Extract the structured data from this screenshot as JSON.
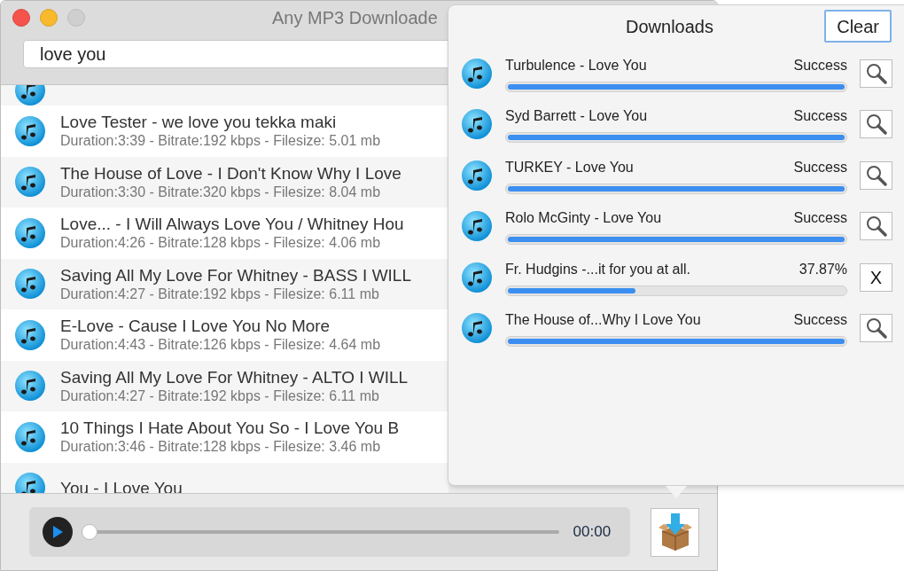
{
  "window": {
    "title": "Any MP3 Downloade"
  },
  "search": {
    "value": "love you"
  },
  "results": [
    {
      "title": "Love Tester - we love you tekka maki",
      "details": "Duration:3:39 - Bitrate:192 kbps - Filesize: 5.01 mb"
    },
    {
      "title": "The House of Love - I Don't Know Why I Love",
      "details": "Duration:3:30 - Bitrate:320 kbps - Filesize: 8.04 mb"
    },
    {
      "title": "Love... - I Will Always Love You / Whitney Hou",
      "details": "Duration:4:26 - Bitrate:128 kbps - Filesize: 4.06 mb"
    },
    {
      "title": "Saving All My Love For Whitney - BASS I WILL",
      "details": "Duration:4:27 - Bitrate:192 kbps - Filesize: 6.11 mb"
    },
    {
      "title": "E-Love - Cause I Love You No More",
      "details": "Duration:4:43 - Bitrate:126 kbps - Filesize: 4.64 mb"
    },
    {
      "title": "Saving All My Love For Whitney - ALTO I WILL",
      "details": "Duration:4:27 - Bitrate:192 kbps - Filesize: 6.11 mb"
    },
    {
      "title": "10 Things I Hate About You So - I Love You B",
      "details": "Duration:3:46 - Bitrate:128 kbps - Filesize: 3.46 mb"
    },
    {
      "title": "You - I Love You"
    }
  ],
  "player": {
    "level": 0,
    "time": "00:00"
  },
  "downloads": {
    "title": "Downloads",
    "clear_button": "Clear",
    "items": [
      {
        "kind": "done",
        "name": "Turbulence - Love You",
        "status": "Success",
        "level": 1
      },
      {
        "kind": "done",
        "name": "Syd Barrett - Love You",
        "status": "Success",
        "level": 1
      },
      {
        "kind": "done",
        "name": "TURKEY - Love You",
        "status": "Success",
        "level": 1
      },
      {
        "kind": "done",
        "name": "Rolo McGinty - Love You",
        "status": "Success",
        "level": 1
      },
      {
        "kind": "active",
        "name": "Fr. Hudgins -...it for you at all.",
        "status": "37.87%",
        "level": 0.3787,
        "action": "X"
      },
      {
        "kind": "done",
        "name": "The House of...Why I Love You",
        "status": "Success",
        "level": 1
      }
    ]
  }
}
